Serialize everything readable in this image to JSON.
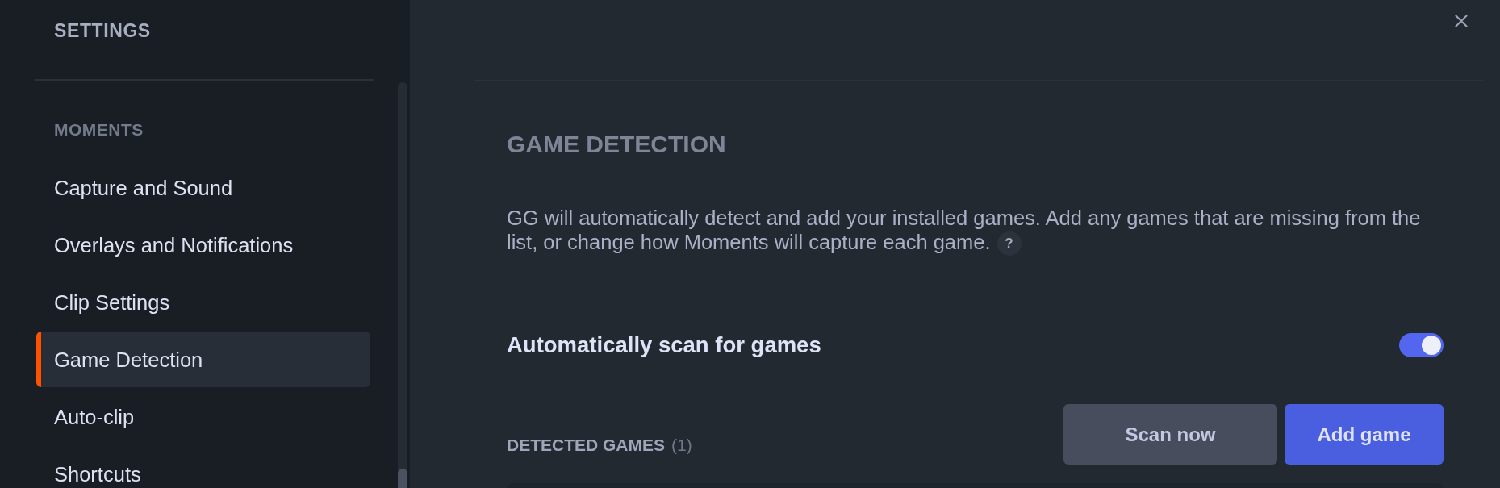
{
  "sidebar": {
    "title": "SETTINGS",
    "section": "MOMENTS",
    "items": [
      {
        "label": "Capture and Sound",
        "selected": false
      },
      {
        "label": "Overlays and Notifications",
        "selected": false
      },
      {
        "label": "Clip Settings",
        "selected": false
      },
      {
        "label": "Game Detection",
        "selected": true
      },
      {
        "label": "Auto-clip",
        "selected": false
      },
      {
        "label": "Shortcuts",
        "selected": false
      }
    ]
  },
  "page": {
    "title": "GAME DETECTION",
    "description": "GG will automatically detect and add your installed games. Add any games that are missing from the list, or change how Moments will capture each game.",
    "help": "?"
  },
  "settings": [
    {
      "label": "Automatically scan for games",
      "kind": "toggle",
      "on": true
    }
  ],
  "detected_games": {
    "label": "DETECTED GAMES",
    "count": "(1)"
  },
  "buttons": [
    {
      "label": "Scan now",
      "kind": "secondary"
    },
    {
      "label": "Add game",
      "kind": "primary"
    }
  ]
}
